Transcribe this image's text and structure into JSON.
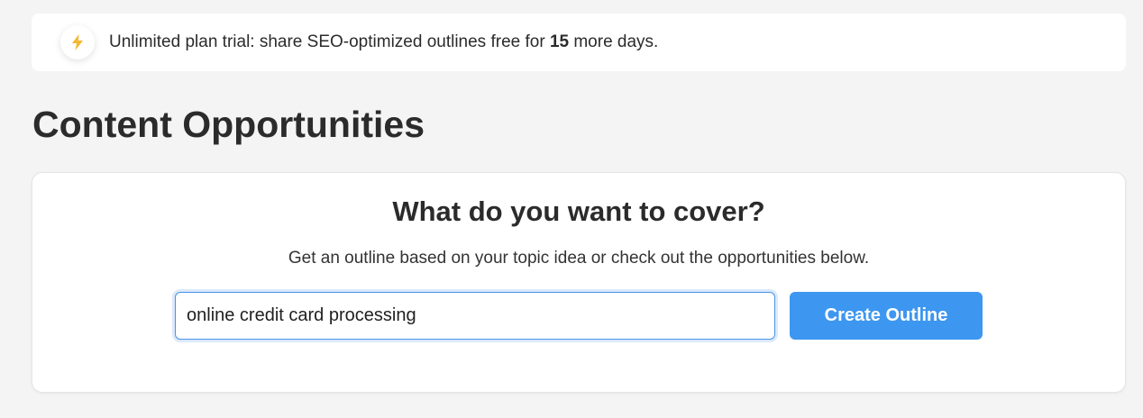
{
  "banner": {
    "icon": "lightning-bolt-icon",
    "icon_color": "#f5b731",
    "text_before": "Unlimited plan trial: share SEO-optimized outlines free for ",
    "days": "15",
    "text_after": " more days."
  },
  "page": {
    "title": "Content Opportunities"
  },
  "card": {
    "heading": "What do you want to cover?",
    "subtext": "Get an outline based on your topic idea or check out the opportunities below.",
    "topic_input_value": "online credit card processing",
    "create_button_label": "Create Outline",
    "button_color": "#3d97f0"
  }
}
